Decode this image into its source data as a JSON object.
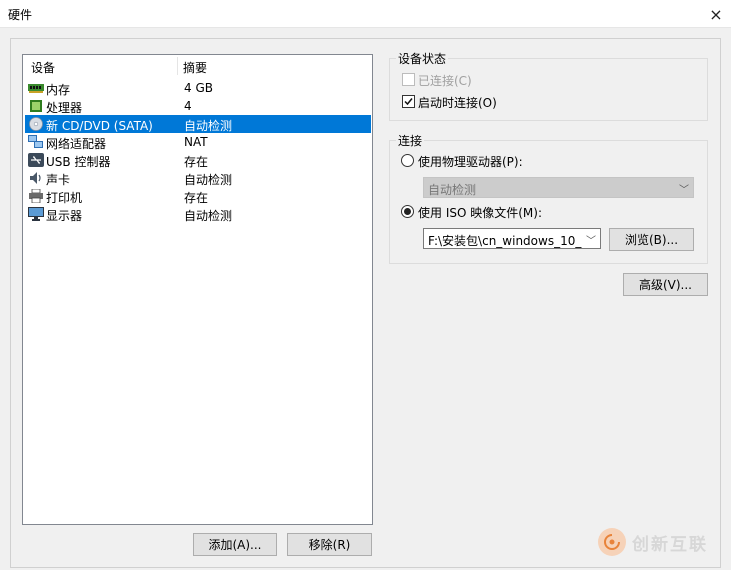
{
  "window": {
    "title": "硬件",
    "close_glyph": "×"
  },
  "device_list": {
    "headers": {
      "device": "设备",
      "summary": "摘要"
    },
    "items": [
      {
        "icon": "memory-icon",
        "name": "内存",
        "summary": "4 GB",
        "selected": false
      },
      {
        "icon": "processor-icon",
        "name": "处理器",
        "summary": "4",
        "selected": false
      },
      {
        "icon": "cd-dvd-icon",
        "name": "新 CD/DVD (SATA)",
        "summary": "自动检测",
        "selected": true
      },
      {
        "icon": "network-adapter-icon",
        "name": "网络适配器",
        "summary": "NAT",
        "selected": false
      },
      {
        "icon": "usb-icon",
        "name": "USB 控制器",
        "summary": "存在",
        "selected": false
      },
      {
        "icon": "sound-card-icon",
        "name": "声卡",
        "summary": "自动检测",
        "selected": false
      },
      {
        "icon": "printer-icon",
        "name": "打印机",
        "summary": "存在",
        "selected": false
      },
      {
        "icon": "display-icon",
        "name": "显示器",
        "summary": "自动检测",
        "selected": false
      }
    ]
  },
  "device_status": {
    "title": "设备状态",
    "connected": {
      "label": "已连接(C)",
      "checked": false,
      "enabled": false
    },
    "connect_at_power_on": {
      "label": "启动时连接(O)",
      "checked": true,
      "enabled": true
    }
  },
  "connection": {
    "title": "连接",
    "physical_drive": {
      "label": "使用物理驱动器(P):",
      "selected": false,
      "value": "自动检测"
    },
    "iso_image": {
      "label": "使用 ISO 映像文件(M):",
      "selected": true,
      "value": "F:\\安装包\\cn_windows_10_"
    },
    "browse_label": "浏览(B)..."
  },
  "buttons": {
    "advanced": "高级(V)...",
    "add": "添加(A)...",
    "remove": "移除(R)"
  },
  "watermark": {
    "text": "创新互联"
  },
  "colors": {
    "selection": "#0078d7",
    "background": "#f0f0f0"
  }
}
